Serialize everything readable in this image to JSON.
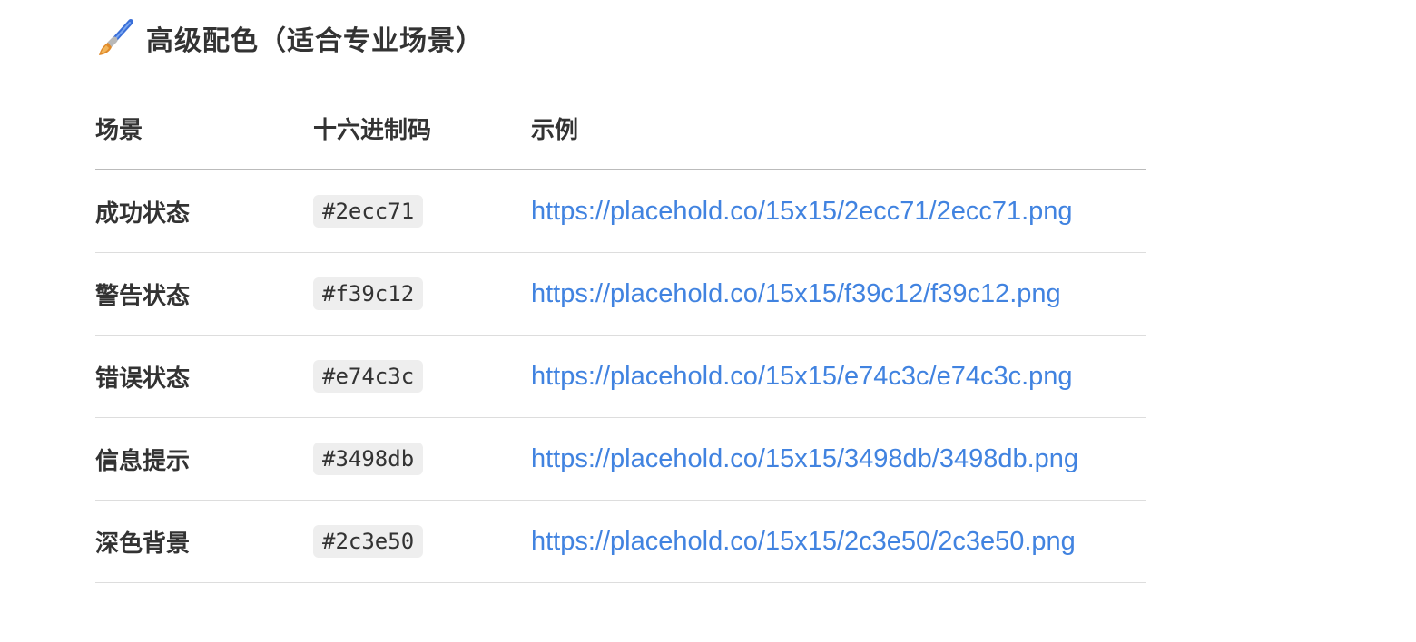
{
  "heading": {
    "icon": "paintbrush-icon",
    "text": "高级配色（适合专业场景）"
  },
  "table": {
    "headers": [
      "场景",
      "十六进制码",
      "示例"
    ],
    "rows": [
      {
        "scene": "成功状态",
        "hex": "#2ecc71",
        "example": "https://placehold.co/15x15/2ecc71/2ecc71.png"
      },
      {
        "scene": "警告状态",
        "hex": "#f39c12",
        "example": "https://placehold.co/15x15/f39c12/f39c12.png"
      },
      {
        "scene": "错误状态",
        "hex": "#e74c3c",
        "example": "https://placehold.co/15x15/e74c3c/e74c3c.png"
      },
      {
        "scene": "信息提示",
        "hex": "#3498db",
        "example": "https://placehold.co/15x15/3498db/3498db.png"
      },
      {
        "scene": "深色背景",
        "hex": "#2c3e50",
        "example": "https://placehold.co/15x15/2c3e50/2c3e50.png"
      }
    ]
  },
  "colors": {
    "text": "#333333",
    "link": "#4183e0",
    "code_bg": "#eeeeee"
  }
}
